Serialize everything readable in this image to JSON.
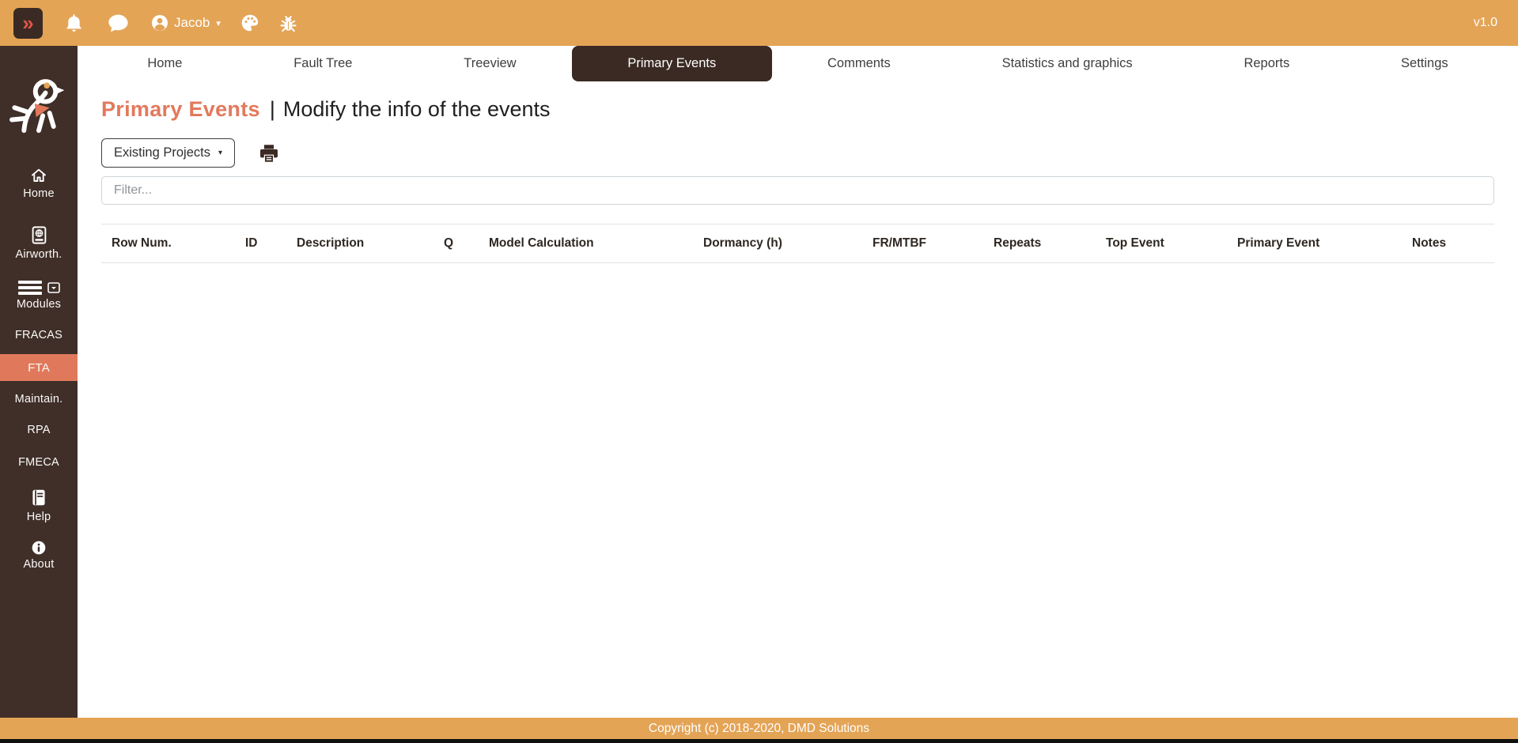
{
  "app": {
    "version": "v1.0"
  },
  "topbar": {
    "user_name": "Jacob"
  },
  "icons": {
    "double_chevron_right": "»",
    "caret_down": "▾"
  },
  "sidebar": {
    "items": [
      {
        "label": "Home"
      },
      {
        "label": "Airworth."
      },
      {
        "label": "Modules"
      },
      {
        "label": "FRACAS"
      },
      {
        "label": "FTA",
        "active": true
      },
      {
        "label": "Maintain."
      },
      {
        "label": "RPA"
      },
      {
        "label": "FMECA"
      },
      {
        "label": "Help"
      },
      {
        "label": "About"
      }
    ]
  },
  "tabs": [
    {
      "label": "Home"
    },
    {
      "label": "Fault Tree"
    },
    {
      "label": "Treeview"
    },
    {
      "label": "Primary Events",
      "active": true
    },
    {
      "label": "Comments"
    },
    {
      "label": "Statistics and graphics"
    },
    {
      "label": "Reports"
    },
    {
      "label": "Settings"
    }
  ],
  "page": {
    "title": "Primary Events",
    "separator": "|",
    "subtitle": "Modify the info of the events"
  },
  "toolbar": {
    "projects_button_label": "Existing Projects"
  },
  "filter": {
    "placeholder": "Filter..."
  },
  "table": {
    "columns": [
      "Row Num.",
      "ID",
      "Description",
      "Q",
      "Model Calculation",
      "Dormancy (h)",
      "FR/MTBF",
      "Repeats",
      "Top Event",
      "Primary Event",
      "Notes"
    ],
    "rows": []
  },
  "footer": {
    "copyright": "Copyright (c) 2018-2020, DMD Solutions"
  },
  "colors": {
    "accent_orange": "#E4A456",
    "sidebar_brown": "#3F2F28",
    "active_dark": "#3A2A23",
    "salmon": "#E0795B",
    "chevron_red": "#E1564A",
    "border_gray": "#DEE2E6"
  }
}
